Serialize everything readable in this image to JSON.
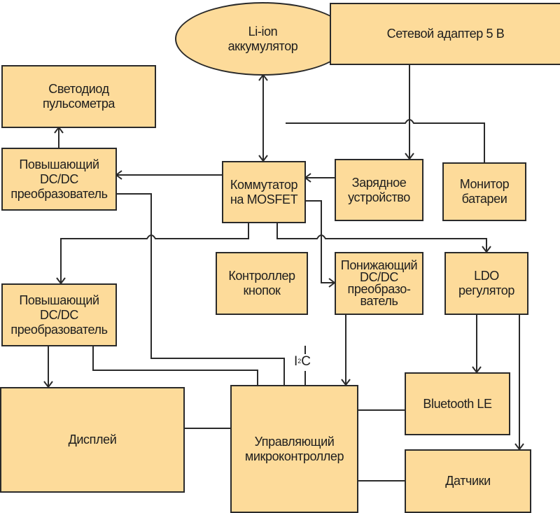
{
  "diagram": {
    "fill_color": "#fddb9a",
    "line_color": "#2a2a2a",
    "blocks": {
      "battery": "Li-ion\nаккумулятор",
      "adapter": "Сетевой адаптер 5 В",
      "led": "Светодиод\nпульсометра",
      "boost_top": "Повышающий\nDC/DC\nпреобразователь",
      "switch": "Коммутатор\nна MOSFET",
      "charger": "Зарядное\nустройство",
      "monitor": "Монитор\nбатареи",
      "boost_bottom": "Повышающий\nDC/DC\nпреобразователь",
      "buttons": "Контроллер\nкнопок",
      "buck": "Понижающий\nDC/DC\nпреобразо-\nватель",
      "ldo": "LDO\nрегулятор",
      "display": "Дисплей",
      "mcu": "Управляющий\nмикроконтроллер",
      "bluetooth": "Bluetooth LE",
      "sensors": "Датчики"
    },
    "bus_label": {
      "main": "I",
      "sup": "2",
      "tail": "C"
    },
    "connections": [
      {
        "from": "battery",
        "to": "switch",
        "type": "bidirectional"
      },
      {
        "from": "adapter",
        "to": "charger",
        "type": "arrow"
      },
      {
        "from": "battery",
        "to": "monitor",
        "type": "line"
      },
      {
        "from": "charger",
        "to": "switch",
        "type": "arrow"
      },
      {
        "from": "switch",
        "to": "boost_top",
        "type": "arrow"
      },
      {
        "from": "boost_top",
        "to": "led",
        "type": "arrow"
      },
      {
        "from": "switch",
        "to": "boost_bottom",
        "type": "arrow"
      },
      {
        "from": "switch",
        "to": "buck",
        "type": "arrow"
      },
      {
        "from": "switch",
        "to": "ldo",
        "type": "arrow"
      },
      {
        "from": "boost_bottom",
        "to": "display",
        "type": "arrow"
      },
      {
        "from": "boost_bottom",
        "to": "mcu",
        "type": "line"
      },
      {
        "from": "boost_top",
        "to": "mcu",
        "type": "line"
      },
      {
        "from": "buck",
        "to": "mcu",
        "type": "arrow"
      },
      {
        "from": "ldo",
        "to": "bluetooth",
        "type": "arrow"
      },
      {
        "from": "ldo",
        "to": "sensors",
        "type": "arrow"
      },
      {
        "from": "display",
        "to": "mcu",
        "type": "line"
      },
      {
        "from": "mcu",
        "to": "bluetooth",
        "type": "line"
      },
      {
        "from": "mcu",
        "to": "sensors",
        "type": "line"
      }
    ]
  }
}
